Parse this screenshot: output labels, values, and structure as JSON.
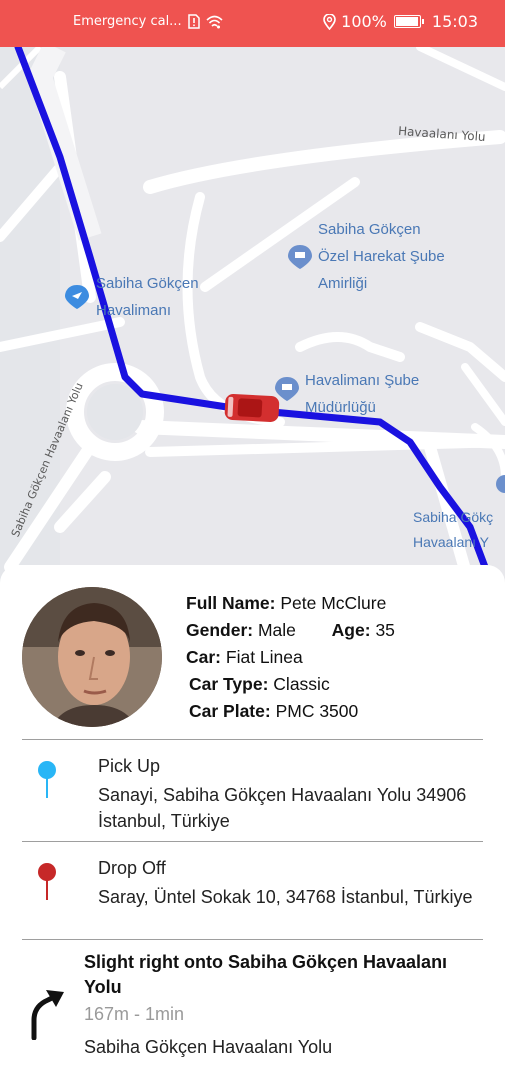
{
  "status_bar": {
    "carrier": "Emergency cal...",
    "battery": "100%",
    "battery_level": 1.0,
    "time": "15:03"
  },
  "map": {
    "labels": {
      "airport": "Sabiha Gökçen\nHavalimanı",
      "ozel": "Sabiha Gökçen\nÖzel Harekat Şube\nAmirliği",
      "havalimani_sube": "Havalimanı Şube\nMüdürlüğü",
      "right_poi": "Sabiha Gökç\nHavaalanı Y",
      "road_top": "Havaalanı Yolu",
      "road_left": "Sabiha Gökçen Havaalanı Yolu"
    },
    "route_color": "#1a12e0",
    "car_color": "#d32f2f"
  },
  "driver": {
    "full_name_label": "Full Name:",
    "full_name": "Pete McClure",
    "gender_label": "Gender:",
    "gender": "Male",
    "age_label": "Age:",
    "age": "35",
    "car_label": "Car:",
    "car": "Fiat Linea",
    "car_type_label": "Car Type:",
    "car_type": "Classic",
    "car_plate_label": "Car Plate:",
    "car_plate": "PMC 3500"
  },
  "pickup": {
    "title": "Pick Up",
    "address": "Sanayi, Sabiha Gökçen Havaalanı Yolu 34906 İstanbul, Türkiye",
    "pin_color": "#29b6f6"
  },
  "dropoff": {
    "title": "Drop Off",
    "address": "Saray, Üntel Sokak 10, 34768 İstanbul, Türkiye",
    "pin_color": "#c62828"
  },
  "navigation": {
    "instruction": "Slight right onto Sabiha Gökçen Havaalanı Yolu",
    "distance": "167m - 1min",
    "street": "Sabiha Gökçen Havaalanı Yolu"
  }
}
